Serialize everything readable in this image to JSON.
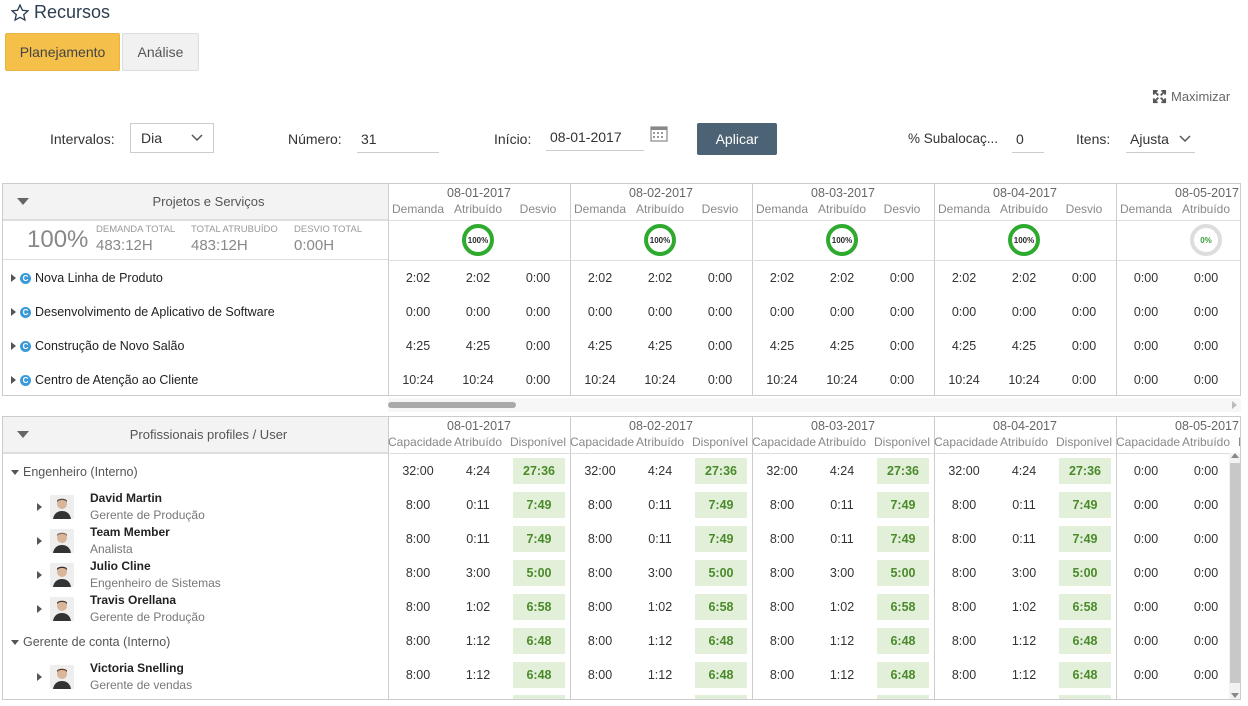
{
  "page": {
    "title": "Recursos"
  },
  "tabs": [
    {
      "label": "Planejamento"
    },
    {
      "label": "Análise"
    }
  ],
  "maximize_label": "Maximizar",
  "filters": {
    "intervals_label": "Intervalos:",
    "intervals_value": "Dia",
    "number_label": "Número:",
    "number_value": "31",
    "start_label": "Início:",
    "start_value": "08-01-2017",
    "apply_label": "Aplicar",
    "sub_label": "% Subalocaç...",
    "sub_value": "0",
    "items_label": "Itens:",
    "items_value": "Ajusta"
  },
  "projects": {
    "header": "Projetos e Serviços",
    "summary": {
      "percent": "100%",
      "demand_label": "DEMANDA TOTAL",
      "demand_value": "483:12H",
      "assigned_label": "TOTAL ATRUBUÍDO",
      "assigned_value": "483:12H",
      "deviation_label": "DESVIO TOTAL",
      "deviation_value": "0:00H"
    },
    "subheaders": [
      "Demanda",
      "Atribuído",
      "Desvio"
    ],
    "rings": [
      "100%",
      "100%",
      "100%",
      "100%",
      "0%"
    ],
    "rows": [
      {
        "name": "Nova Linha de Produto",
        "vals": [
          "2:02",
          "2:02",
          "0:00",
          "2:02",
          "2:02",
          "0:00",
          "2:02",
          "2:02",
          "0:00",
          "2:02",
          "2:02",
          "0:00",
          "0:00",
          "0:00"
        ]
      },
      {
        "name": "Desenvolvimento de Aplicativo de Software",
        "vals": [
          "0:00",
          "0:00",
          "0:00",
          "0:00",
          "0:00",
          "0:00",
          "0:00",
          "0:00",
          "0:00",
          "0:00",
          "0:00",
          "0:00",
          "0:00",
          "0:00"
        ]
      },
      {
        "name": "Construção de Novo Salão",
        "vals": [
          "4:25",
          "4:25",
          "0:00",
          "4:25",
          "4:25",
          "0:00",
          "4:25",
          "4:25",
          "0:00",
          "4:25",
          "4:25",
          "0:00",
          "0:00",
          "0:00"
        ]
      },
      {
        "name": "Centro de Atenção ao Cliente",
        "vals": [
          "10:24",
          "10:24",
          "0:00",
          "10:24",
          "10:24",
          "0:00",
          "10:24",
          "10:24",
          "0:00",
          "10:24",
          "10:24",
          "0:00",
          "0:00",
          "0:00"
        ]
      }
    ]
  },
  "dates": [
    "08-01-2017",
    "08-02-2017",
    "08-03-2017",
    "08-04-2017",
    "08-05-2017"
  ],
  "professionals": {
    "header": "Profissionais profiles / User",
    "subheaders": [
      "Capacidade",
      "Atribuído",
      "Disponível"
    ],
    "rows": [
      {
        "type": "group",
        "name": "Engenheiro (Interno)",
        "vals": [
          "32:00",
          "4:24",
          "27:36",
          "32:00",
          "4:24",
          "27:36",
          "32:00",
          "4:24",
          "27:36",
          "32:00",
          "4:24",
          "27:36",
          "0:00",
          "0:00"
        ]
      },
      {
        "type": "person",
        "name": "David Martin",
        "role": "Gerente de Produção",
        "vals": [
          "8:00",
          "0:11",
          "7:49",
          "8:00",
          "0:11",
          "7:49",
          "8:00",
          "0:11",
          "7:49",
          "8:00",
          "0:11",
          "7:49",
          "0:00",
          "0:00"
        ]
      },
      {
        "type": "person",
        "name": "Team Member",
        "role": "Analista",
        "vals": [
          "8:00",
          "0:11",
          "7:49",
          "8:00",
          "0:11",
          "7:49",
          "8:00",
          "0:11",
          "7:49",
          "8:00",
          "0:11",
          "7:49",
          "0:00",
          "0:00"
        ]
      },
      {
        "type": "person",
        "name": "Julio Cline",
        "role": "Engenheiro de Sistemas",
        "vals": [
          "8:00",
          "3:00",
          "5:00",
          "8:00",
          "3:00",
          "5:00",
          "8:00",
          "3:00",
          "5:00",
          "8:00",
          "3:00",
          "5:00",
          "0:00",
          "0:00"
        ]
      },
      {
        "type": "person",
        "name": "Travis Orellana",
        "role": "Gerente de Produção",
        "vals": [
          "8:00",
          "1:02",
          "6:58",
          "8:00",
          "1:02",
          "6:58",
          "8:00",
          "1:02",
          "6:58",
          "8:00",
          "1:02",
          "6:58",
          "0:00",
          "0:00"
        ]
      },
      {
        "type": "group",
        "name": "Gerente de conta (Interno)",
        "vals": [
          "8:00",
          "1:12",
          "6:48",
          "8:00",
          "1:12",
          "6:48",
          "8:00",
          "1:12",
          "6:48",
          "8:00",
          "1:12",
          "6:48",
          "0:00",
          "0:00"
        ]
      },
      {
        "type": "person",
        "name": "Victoria Snelling",
        "role": "Gerente de vendas",
        "vals": [
          "8:00",
          "1:12",
          "6:48",
          "8:00",
          "1:12",
          "6:48",
          "8:00",
          "1:12",
          "6:48",
          "8:00",
          "1:12",
          "6:48",
          "0:00",
          "0:00"
        ]
      }
    ]
  }
}
